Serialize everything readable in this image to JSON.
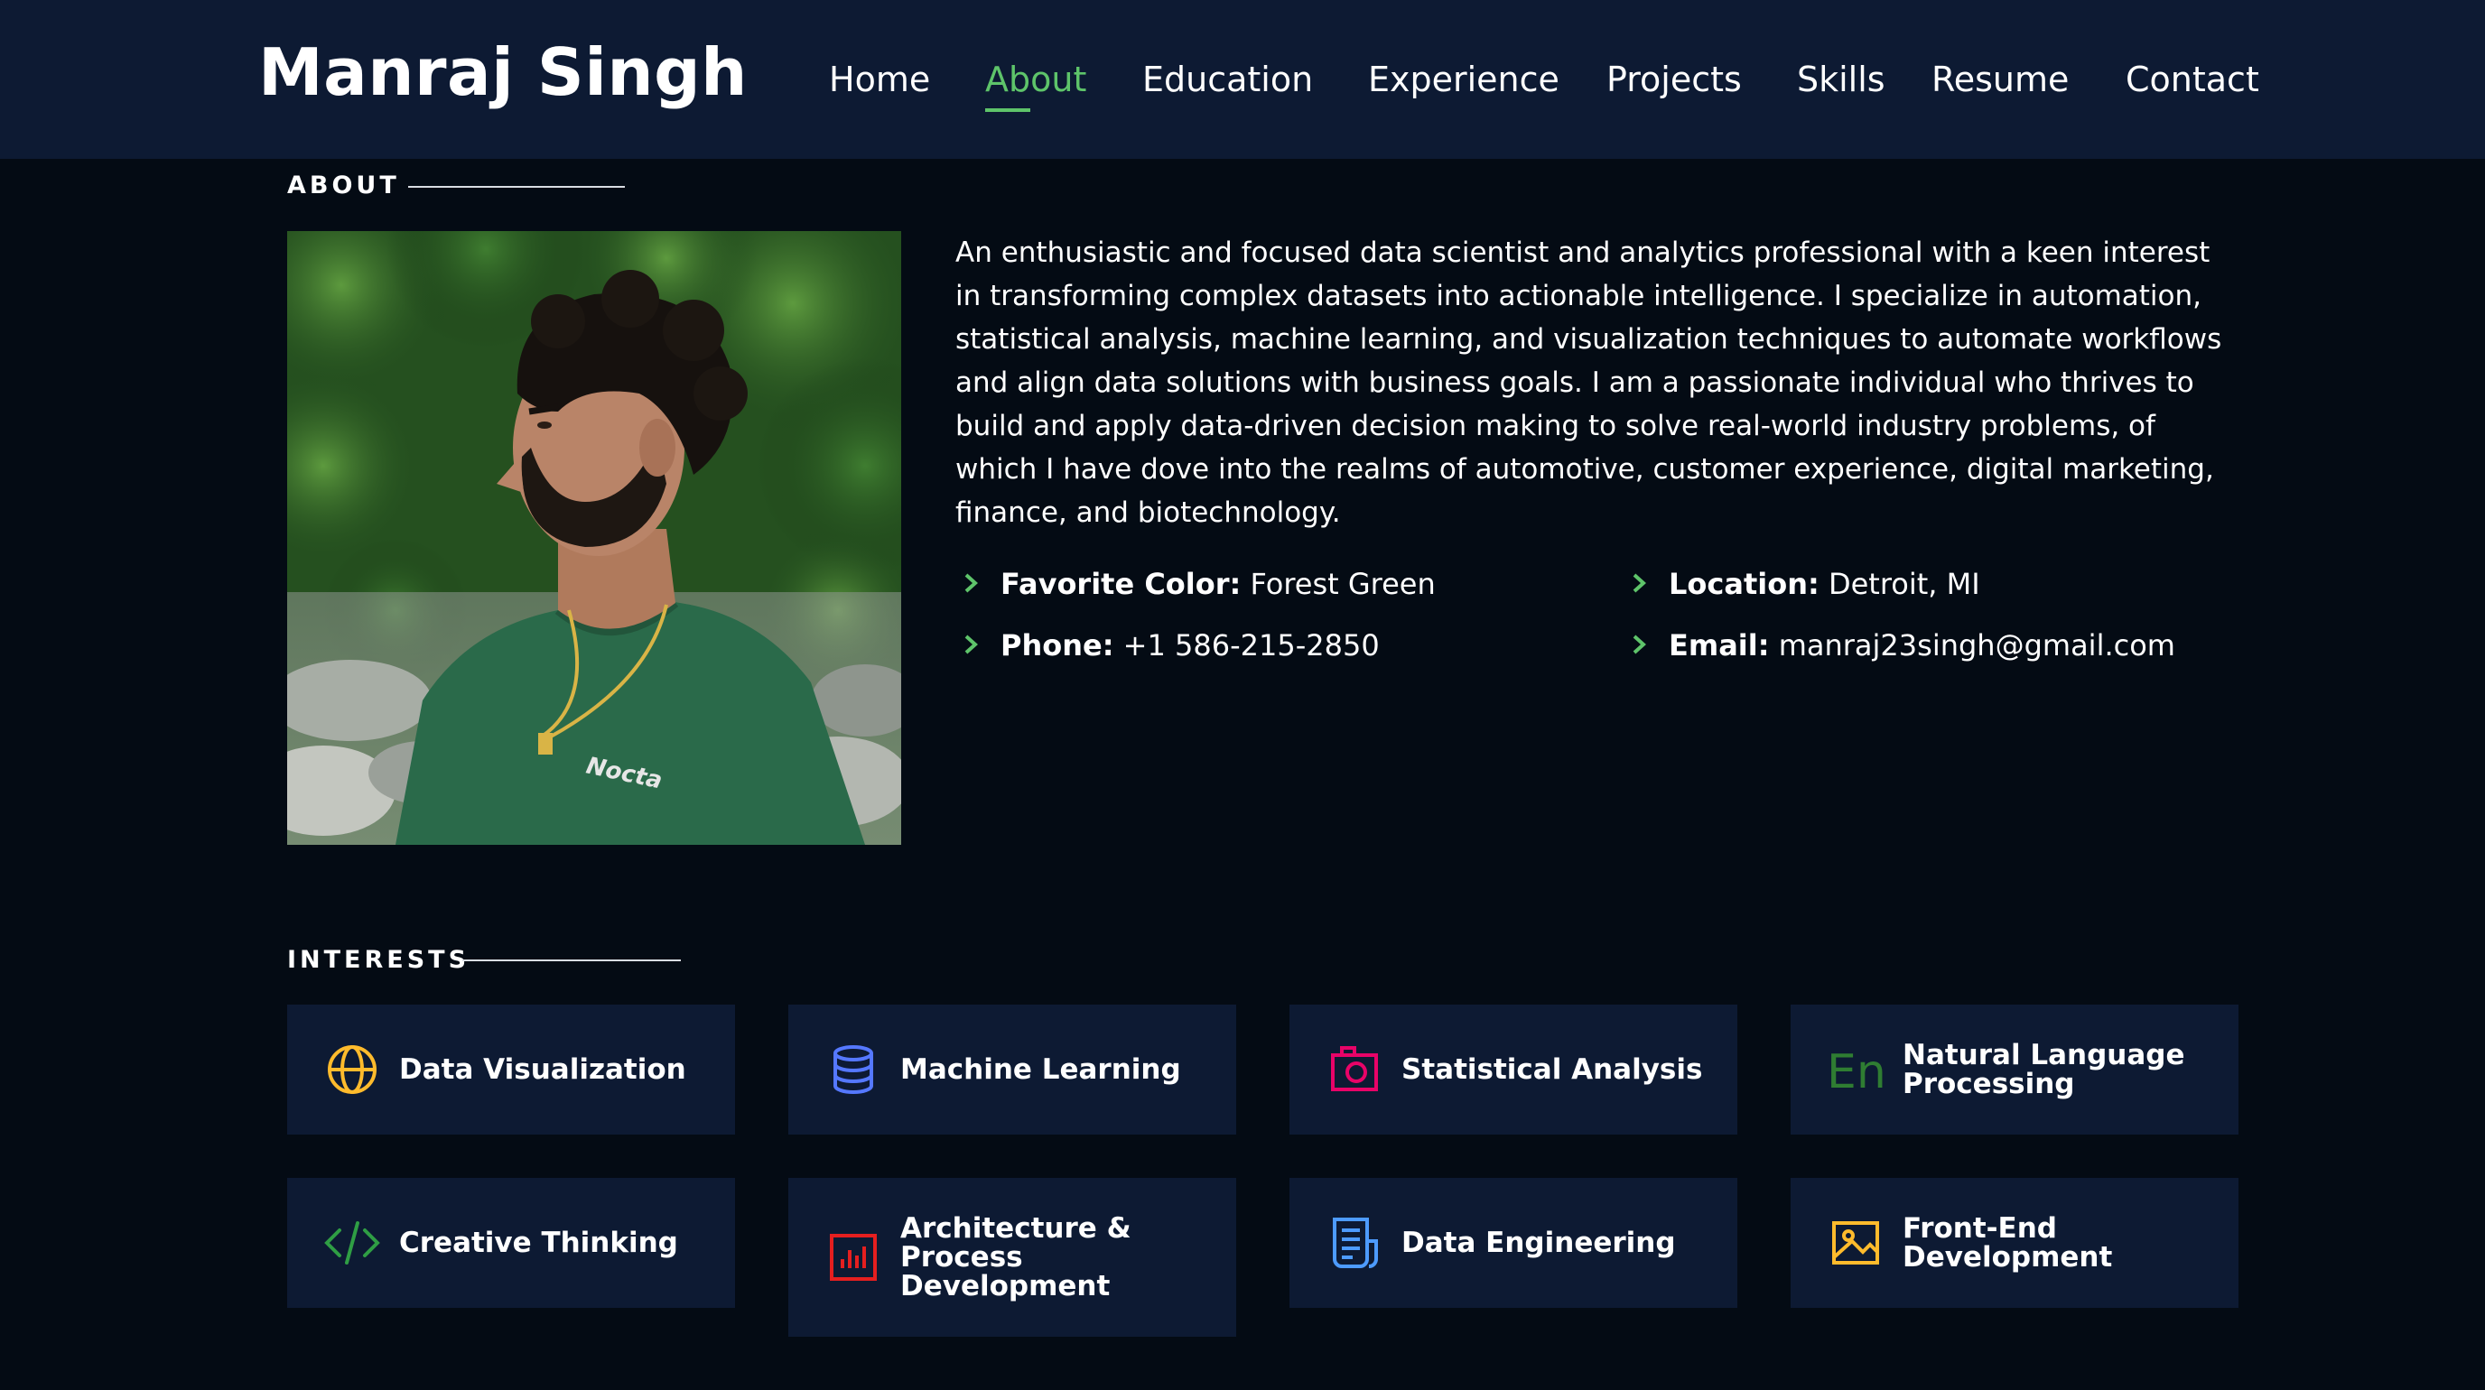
{
  "header": {
    "brand": "Manraj Singh",
    "nav": [
      {
        "label": "Home",
        "active": false
      },
      {
        "label": "About",
        "active": true
      },
      {
        "label": "Education",
        "active": false
      },
      {
        "label": "Experience",
        "active": false
      },
      {
        "label": "Projects",
        "active": false
      },
      {
        "label": "Skills",
        "active": false
      },
      {
        "label": "Resume",
        "active": false
      },
      {
        "label": "Contact",
        "active": false
      }
    ],
    "accent_color": "#5ec46a",
    "background_color": "#0d1a33"
  },
  "about": {
    "section_title": "ABOUT",
    "bio": "An enthusiastic and focused data scientist and analytics professional with a keen interest in transforming complex datasets into actionable intelligence. I specialize in automation, statistical analysis, machine learning, and visualization techniques to automate workflows and align data solutions with business goals. I am a passionate individual who thrives to build and apply data-driven decision making to solve real-world industry problems, of which I have dove into the realms of automotive, customer experience, digital marketing, finance, and biotechnology.",
    "details": [
      {
        "label": "Favorite Color:",
        "value": " Forest Green"
      },
      {
        "label": "Location:",
        "value": " Detroit, MI"
      },
      {
        "label": "Phone:",
        "value": " +1 586-215-2850"
      },
      {
        "label": "Email:",
        "value": " manraj23singh@gmail.com"
      }
    ]
  },
  "interests": {
    "section_title": "INTERESTS",
    "items": [
      {
        "label": "Data Visualization",
        "icon": "globe-icon",
        "color": "#ffbb2c"
      },
      {
        "label": "Machine Learning",
        "icon": "database-icon",
        "color": "#5578ff"
      },
      {
        "label": "Statistical Analysis",
        "icon": "camera-icon",
        "color": "#e80368"
      },
      {
        "label": "Natural Language Processing",
        "icon": "language-icon",
        "color": "#2f7d32"
      },
      {
        "label": "Creative Thinking",
        "icon": "code-icon",
        "color": "#47aeff"
      },
      {
        "label": "Architecture & Process Development",
        "icon": "bar-chart-icon",
        "color": "#e51f1f"
      },
      {
        "label": "Data Engineering",
        "icon": "document-icon",
        "color": "#4d9bff"
      },
      {
        "label": "Front-End Development",
        "icon": "image-icon",
        "color": "#ffbb2c"
      }
    ]
  }
}
